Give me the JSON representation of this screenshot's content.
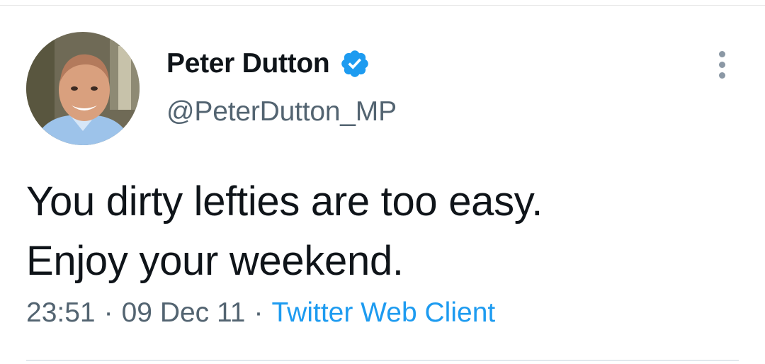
{
  "user": {
    "display_name": "Peter Dutton",
    "handle": "@PeterDutton_MP",
    "verified": true,
    "verified_icon": "verified-badge-icon",
    "verified_color": "#1d9bf0",
    "avatar_icon": "profile-photo"
  },
  "tweet": {
    "lines": [
      "You dirty lefties are too easy.",
      "Enjoy your weekend."
    ]
  },
  "meta": {
    "time": "23:51",
    "separator": "·",
    "date": "09 Dec 11",
    "source": "Twitter Web Client"
  },
  "menu": {
    "icon": "more-options-icon"
  },
  "colors": {
    "text": "#0f1419",
    "secondary": "#536471",
    "link": "#1d9bf0"
  }
}
